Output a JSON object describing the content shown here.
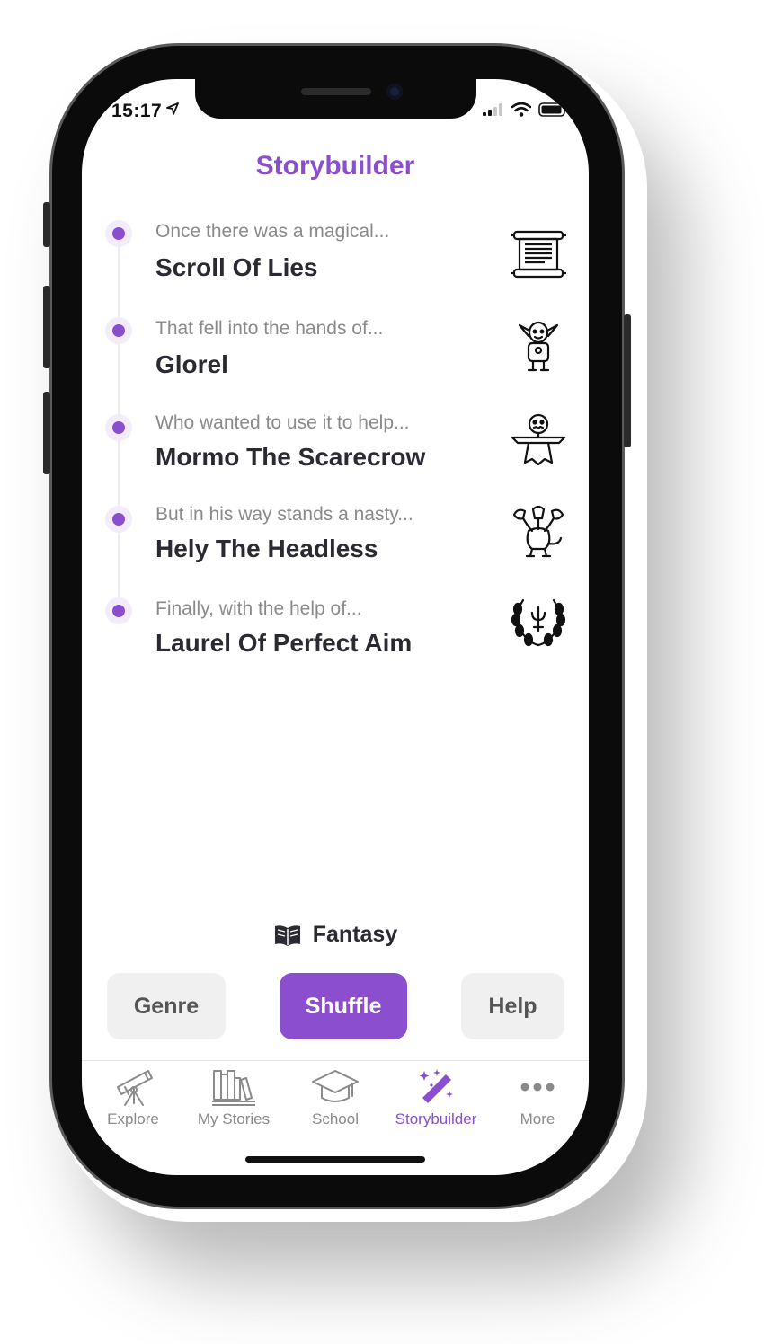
{
  "status_bar": {
    "time": "15:17"
  },
  "header": {
    "title": "Storybuilder"
  },
  "story_steps": [
    {
      "prompt": "Once there was a magical...",
      "answer": "Scroll Of Lies",
      "icon": "scroll-icon"
    },
    {
      "prompt": "That fell into the hands of...",
      "answer": "Glorel",
      "icon": "goblin-icon"
    },
    {
      "prompt": "Who wanted to use it to help...",
      "answer": "Mormo The Scarecrow",
      "icon": "scarecrow-icon"
    },
    {
      "prompt": "But in his way stands a nasty...",
      "answer": "Hely The Headless",
      "icon": "hydra-icon"
    },
    {
      "prompt": "Finally, with the help of...",
      "answer": "Laurel Of Perfect Aim",
      "icon": "laurel-icon"
    }
  ],
  "genre": {
    "label": "Fantasy",
    "icon": "book-icon"
  },
  "actions": {
    "genre": "Genre",
    "shuffle": "Shuffle",
    "help": "Help"
  },
  "tabs": [
    {
      "label": "Explore",
      "icon": "telescope-icon"
    },
    {
      "label": "My Stories",
      "icon": "bookshelf-icon"
    },
    {
      "label": "School",
      "icon": "graduation-cap-icon"
    },
    {
      "label": "Storybuilder",
      "icon": "magic-wand-icon",
      "active": true
    },
    {
      "label": "More",
      "icon": "more-dots-icon"
    }
  ],
  "colors": {
    "accent": "#8a4ecf",
    "text_dark": "#2b2a33",
    "text_muted": "#8a8a8a",
    "button_light": "#f0f0f0"
  }
}
